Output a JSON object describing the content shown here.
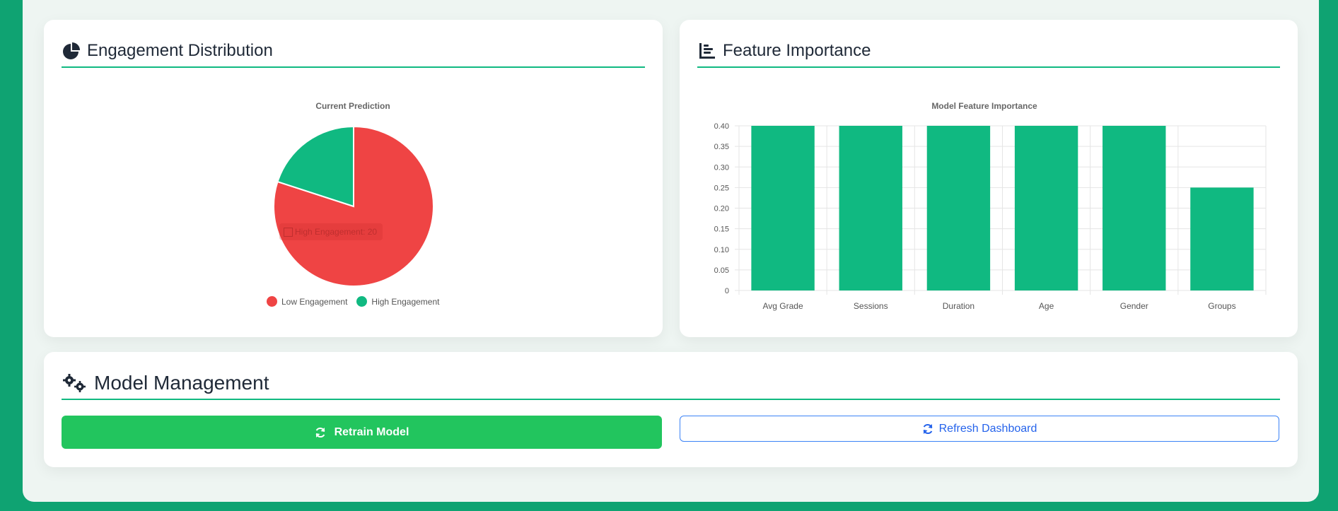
{
  "engagement_card": {
    "title": "Engagement Distribution",
    "icon": "pie-chart-icon",
    "chart_title": "Current Prediction",
    "tooltip_text": "High Engagement: 20",
    "legend": [
      {
        "label": "Low Engagement",
        "color": "#ef4444"
      },
      {
        "label": "High Engagement",
        "color": "#10b981"
      }
    ]
  },
  "feature_card": {
    "title": "Feature Importance",
    "icon": "bar-chart-icon",
    "chart_title": "Model Feature Importance"
  },
  "model_card": {
    "title": "Model Management",
    "icon": "gears-icon",
    "retrain_label": "Retrain Model",
    "refresh_label": "Refresh Dashboard"
  },
  "colors": {
    "accent": "#10b981",
    "low": "#ef4444",
    "retrain": "#22c55e",
    "refresh": "#2563eb"
  },
  "chart_data": [
    {
      "type": "pie",
      "title": "Current Prediction",
      "categories": [
        "Low Engagement",
        "High Engagement"
      ],
      "values": [
        80,
        20
      ],
      "colors": [
        "#ef4444",
        "#10b981"
      ],
      "legend_position": "bottom"
    },
    {
      "type": "bar",
      "title": "Model Feature Importance",
      "categories": [
        "Avg Grade",
        "Sessions",
        "Duration",
        "Age",
        "Gender",
        "Groups"
      ],
      "values": [
        0.4,
        0.4,
        0.4,
        0.4,
        0.4,
        0.25
      ],
      "ylim": [
        0,
        0.4
      ],
      "yticks": [
        "0",
        "0.05",
        "0.10",
        "0.15",
        "0.20",
        "0.25",
        "0.30",
        "0.35",
        "0.40"
      ],
      "grid": true,
      "color": "#10b981"
    }
  ]
}
